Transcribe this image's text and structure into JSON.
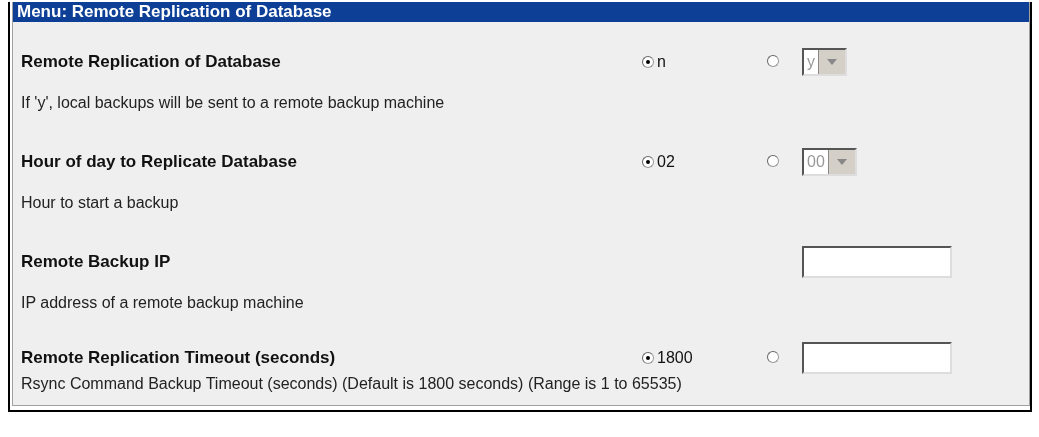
{
  "header": "Menu: Remote Replication of Database",
  "settings": [
    {
      "title": "Remote Replication of Database",
      "description": "If 'y', local backups will be sent to a remote backup machine",
      "default": {
        "label": "n",
        "selected": true
      },
      "alternate": {
        "selected": false
      },
      "field": {
        "kind": "select",
        "value": "y",
        "disabled": true
      }
    },
    {
      "title": "Hour of day to Replicate Database",
      "description": "Hour to start a backup",
      "default": {
        "label": "02",
        "selected": true
      },
      "alternate": {
        "selected": false
      },
      "field": {
        "kind": "select",
        "value": "00",
        "disabled": true
      }
    },
    {
      "title": "Remote Backup IP",
      "description": "IP address of a remote backup machine",
      "field": {
        "kind": "input"
      }
    },
    {
      "title": "Remote Replication Timeout (seconds)",
      "description": "Rsync Command Backup Timeout (seconds) (Default is 1800 seconds) (Range is 1 to 65535)",
      "default": {
        "label": "1800",
        "selected": true
      },
      "alternate": {
        "selected": false
      },
      "field": {
        "kind": "input"
      }
    }
  ]
}
